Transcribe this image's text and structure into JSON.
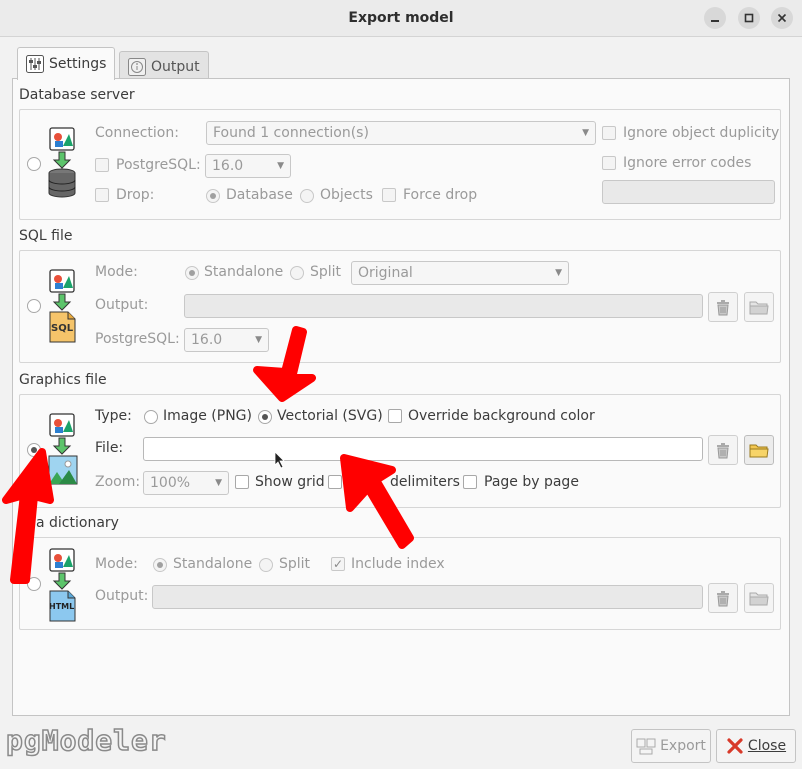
{
  "window": {
    "title": "Export model"
  },
  "tabs": [
    {
      "label": "Settings",
      "icon": "settings-icon"
    },
    {
      "label": "Output",
      "icon": "info-icon"
    }
  ],
  "database_server": {
    "title": "Database server",
    "connection_label": "Connection:",
    "connection_value": "Found 1 connection(s)",
    "postgresql_label": "PostgreSQL:",
    "postgresql_version": "16.0",
    "drop_label": "Drop:",
    "database_label": "Database",
    "objects_label": "Objects",
    "force_drop_label": "Force drop",
    "ignore_duplicity_label": "Ignore object duplicity",
    "ignore_error_codes_label": "Ignore error codes"
  },
  "sql_file": {
    "title": "SQL file",
    "icon_text": "SQL",
    "mode_label": "Mode:",
    "standalone_label": "Standalone",
    "split_label": "Split",
    "split_mode_value": "Original",
    "output_label": "Output:",
    "postgresql_label": "PostgreSQL:",
    "postgresql_version": "16.0"
  },
  "graphics_file": {
    "title": "Graphics file",
    "type_label": "Type:",
    "png_label": "Image (PNG)",
    "svg_label": "Vectorial (SVG)",
    "override_bg_label": "Override background color",
    "file_label": "File:",
    "file_value": "",
    "zoom_label": "Zoom:",
    "zoom_value": "100%",
    "show_grid_label": "Show grid",
    "delimiters_label": "delimiters",
    "page_by_page_label": "Page by page"
  },
  "data_dictionary": {
    "title": "a dictionary",
    "icon_text": "HTML",
    "mode_label": "Mode:",
    "standalone_label": "Standalone",
    "split_label": "Split",
    "include_index_label": "Include index",
    "output_label": "Output:"
  },
  "footer": {
    "logo": "pgModeler",
    "export_label": "Export",
    "close_label": "Close"
  },
  "colors": {
    "annotation_arrow": "#ff0000",
    "window_bg": "#f2f2f2",
    "panel_bg": "#fafafa"
  }
}
